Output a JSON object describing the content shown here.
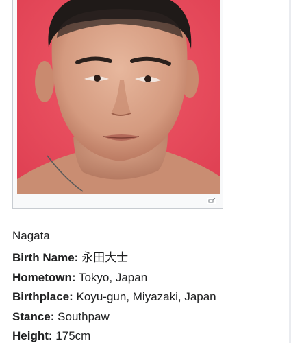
{
  "caption": "Nagata",
  "infobox": [
    {
      "label": "Birth Name:",
      "value": "永田大士"
    },
    {
      "label": "Hometown:",
      "value": "Tokyo, Japan"
    },
    {
      "label": "Birthplace:",
      "value": "Koyu-gun, Miyazaki, Japan"
    },
    {
      "label": "Stance:",
      "value": "Southpaw"
    },
    {
      "label": "Height:",
      "value": "175cm"
    }
  ],
  "icons": {
    "enlarge": "magnify-clip-icon"
  },
  "colors": {
    "photo_background": "#e8495a",
    "thumb_border": "#c8ccd1"
  }
}
